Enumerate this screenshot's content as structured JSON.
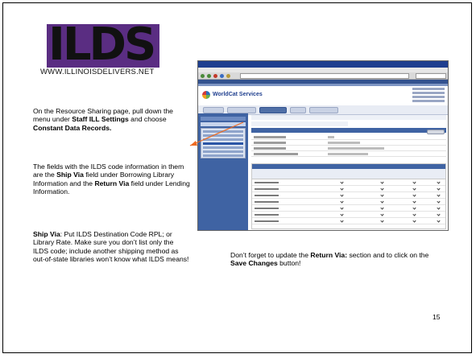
{
  "logo": {
    "letters": "ILDS",
    "url": "WWW.ILLINOISDELIVERS.NET",
    "colors": {
      "block": "#5a2d82",
      "text": "#111111"
    }
  },
  "instructions": {
    "p1": {
      "a": "On the Resource Sharing page, pull down the menu under ",
      "b1": "Staff ILL Settings",
      "c": " and choose ",
      "b2": "Constant Data Records."
    },
    "p2": {
      "a": "The fields with the ILDS code information in them are the ",
      "b1": "Ship Via",
      "c": " field under Borrowing Library Information and the ",
      "b2": "Return Via",
      "d": " field under Lending Information."
    },
    "p3": {
      "b1": "Ship Via",
      "a": ": Put ILDS Destination Code RPL; or Library Rate. Make sure you don’t list only the ILDS code; include another shipping method as out-of-state libraries won’t know what ILDS means!"
    }
  },
  "caption": {
    "a": "Don’t forget to update the ",
    "b1": "Return Via:",
    "c": " section and to click on the ",
    "b2": "Save Changes",
    "d": " button!"
  },
  "page_number": "15",
  "screenshot": {
    "service_name": "WorldCat Services",
    "arrow_color": "#ee6a20",
    "accent": "#3f63a3"
  }
}
